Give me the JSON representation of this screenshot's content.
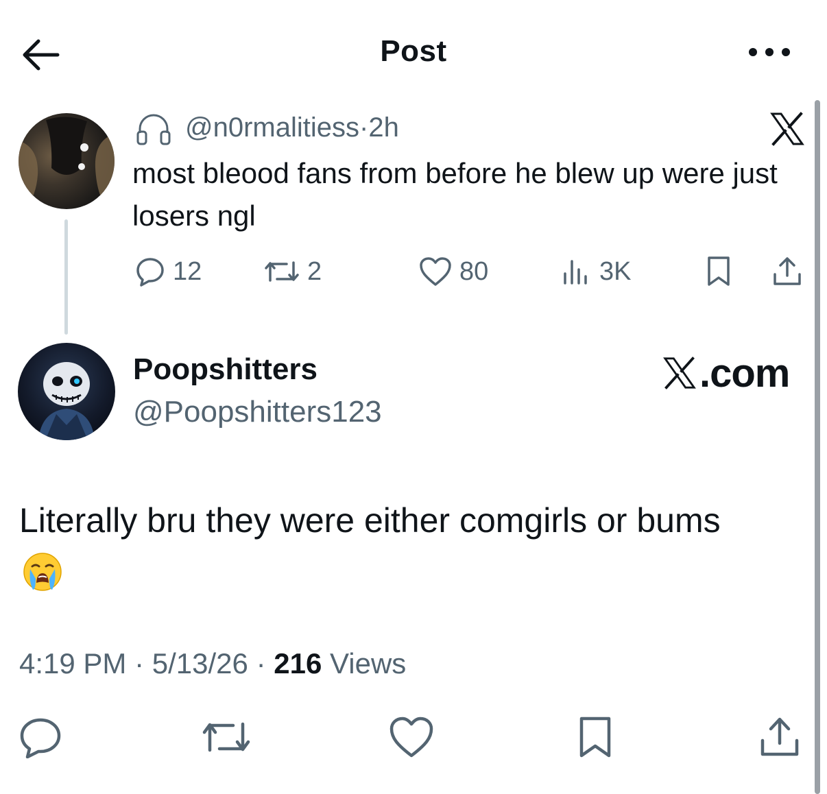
{
  "header": {
    "title": "Post"
  },
  "quoted_post": {
    "handle": "@n0rmalitiess",
    "separator": "·",
    "time": "2h",
    "text": "most bleood fans from before he blew up were just losers ngl",
    "replies": "12",
    "reposts": "2",
    "likes": "80",
    "views": "3K",
    "platform_icon": "x-logo-icon",
    "badge_icon": "headphones-icon"
  },
  "post": {
    "display_name": "Poopshitters",
    "handle": "@Poopshitters123",
    "source_label": ".com",
    "source_icon": "x-logo-icon",
    "text": "Literally bru they were either comgirls or bums",
    "emoji": "😭",
    "time": "4:19 PM",
    "date": "5/13/26",
    "separator": "·",
    "views_count": "216",
    "views_label": "Views"
  },
  "colors": {
    "text": "#0f1419",
    "secondary": "#536471",
    "thread_line": "#cfd9de",
    "icon": "#536471"
  }
}
